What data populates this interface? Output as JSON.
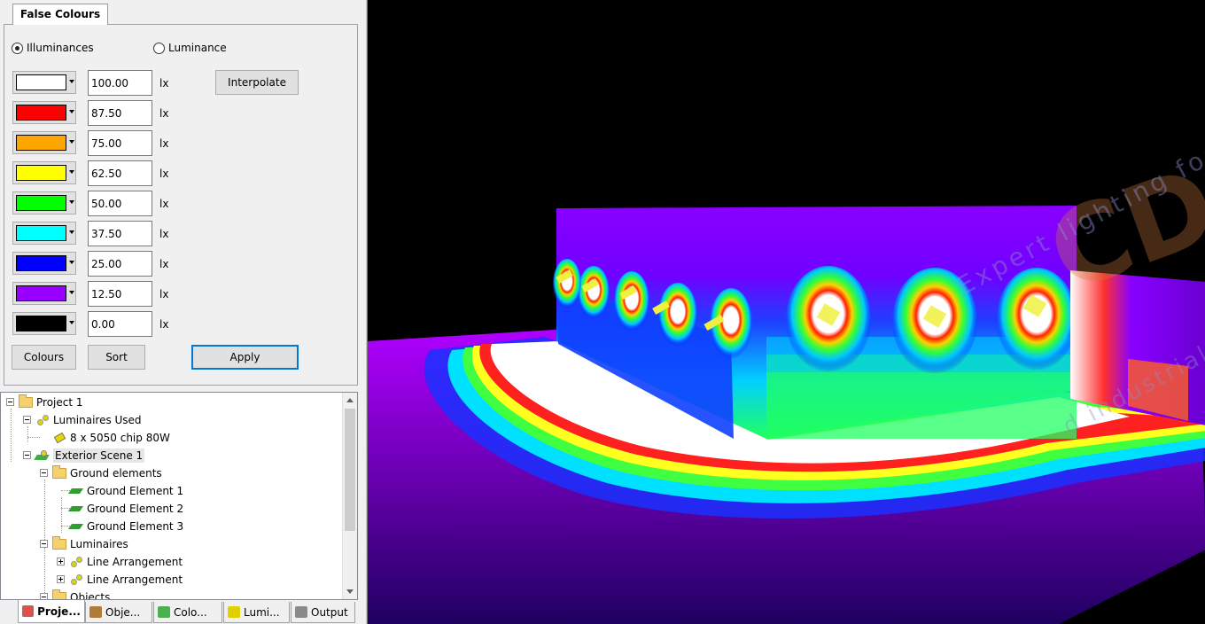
{
  "false_colours": {
    "tab_title": "False Colours",
    "mode_options": [
      {
        "label": "Illuminances",
        "selected": true
      },
      {
        "label": "Luminance",
        "selected": false
      }
    ],
    "rows": [
      {
        "color": "#ffffff",
        "value": "100.00",
        "unit": "lx"
      },
      {
        "color": "#ff0000",
        "value": "87.50",
        "unit": "lx"
      },
      {
        "color": "#ffa500",
        "value": "75.00",
        "unit": "lx"
      },
      {
        "color": "#ffff00",
        "value": "62.50",
        "unit": "lx"
      },
      {
        "color": "#00ff00",
        "value": "50.00",
        "unit": "lx"
      },
      {
        "color": "#00ffff",
        "value": "37.50",
        "unit": "lx"
      },
      {
        "color": "#0000ff",
        "value": "25.00",
        "unit": "lx"
      },
      {
        "color": "#9900ff",
        "value": "12.50",
        "unit": "lx"
      },
      {
        "color": "#000000",
        "value": "0.00",
        "unit": "lx"
      }
    ],
    "interpolate_label": "Interpolate",
    "colours_label": "Colours",
    "sort_label": "Sort",
    "apply_label": "Apply"
  },
  "tree": {
    "project": "Project 1",
    "luminaires_used": "Luminaires Used",
    "luminaire_entry": "8 x    5050 chip 80W",
    "scene": "Exterior Scene 1",
    "ground_elements": "Ground elements",
    "ground_items": [
      "Ground Element 1",
      "Ground Element 2",
      "Ground Element 3"
    ],
    "luminaires": "Luminaires",
    "arrangements": [
      "Line Arrangement",
      "Line Arrangement"
    ],
    "objects": "Objects"
  },
  "bottom_tabs": [
    {
      "label": "Proje...",
      "icon": "project-icon",
      "color": "#d9534f",
      "active": true
    },
    {
      "label": "Obje...",
      "icon": "objects-icon",
      "color": "#b07a3a",
      "active": false
    },
    {
      "label": "Colo...",
      "icon": "colours-icon",
      "color": "#4caf50",
      "active": false
    },
    {
      "label": "Lumi...",
      "icon": "luminaires-icon",
      "color": "#e0d000",
      "active": false
    },
    {
      "label": "Output",
      "icon": "output-icon",
      "color": "#8a8a8a",
      "active": false
    }
  ],
  "viewport": {
    "watermark_logo": "CD",
    "watermark_line1": "Expert lighting for harsh,hazardous",
    "watermark_line2": "d industrial areas"
  }
}
